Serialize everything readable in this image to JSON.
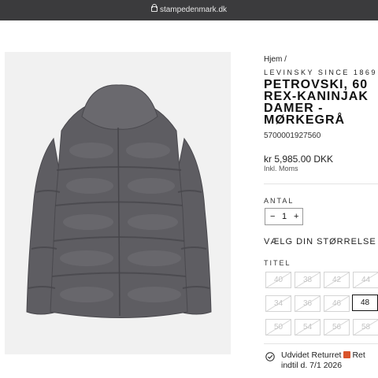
{
  "browser": {
    "url": "stampedenmark.dk"
  },
  "breadcrumb": "Hjem /",
  "product": {
    "brand": "LEVINSKY SINCE 1869",
    "title_lines": [
      "PETROVSKI, 60",
      "REX-KANINJAK",
      "DAMER -",
      "MØRKEGRÅ"
    ],
    "sku": "5700001927560",
    "price": "kr 5,985.00 DKK",
    "vat_note": "Inkl. Moms"
  },
  "quantity": {
    "label": "ANTAL",
    "minus": "−",
    "value": "1",
    "plus": "+"
  },
  "size": {
    "heading": "VÆLG DIN STØRRELSE",
    "group_label": "TITEL",
    "options": [
      {
        "label": "40",
        "available": false
      },
      {
        "label": "38",
        "available": false
      },
      {
        "label": "42",
        "available": false
      },
      {
        "label": "44",
        "available": false
      },
      {
        "label": "34",
        "available": false
      },
      {
        "label": "36",
        "available": false
      },
      {
        "label": "46",
        "available": false
      },
      {
        "label": "48",
        "available": true
      },
      {
        "label": "50",
        "available": false
      },
      {
        "label": "54",
        "available": false
      },
      {
        "label": "56",
        "available": false
      },
      {
        "label": "58",
        "available": false
      }
    ]
  },
  "returns": {
    "line1_pre": "Udvidet Returret",
    "gift_icon": "gift-icon",
    "line1_post": "Ret",
    "line2": "indtil d. 7/1 2026"
  },
  "colors": {
    "fur": "#5e5d62",
    "topbar": "#3b3b3d",
    "gift": "#d9542b"
  }
}
